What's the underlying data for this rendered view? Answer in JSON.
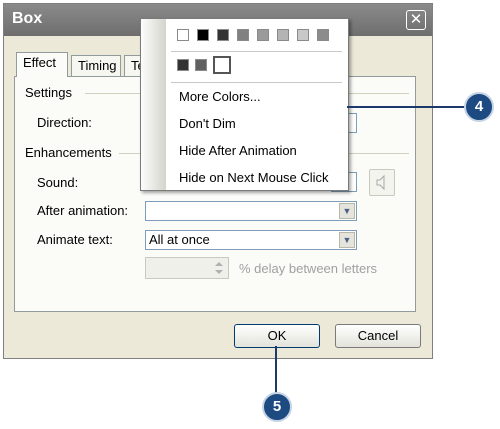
{
  "window": {
    "title": "Box",
    "close_glyph": "✕"
  },
  "tabs": [
    {
      "label": "Effect"
    },
    {
      "label": "Timing"
    },
    {
      "label": "Te"
    }
  ],
  "settings": {
    "group_label": "Settings",
    "direction_label": "Direction:"
  },
  "enhancements": {
    "group_label": "Enhancements",
    "sound_label": "Sound:",
    "after_animation_label": "After animation:",
    "after_animation_value": "",
    "animate_text_label": "Animate text:",
    "animate_text_value": "All at once",
    "delay_value": "",
    "delay_label": "% delay between letters"
  },
  "buttons": {
    "ok": "OK",
    "cancel": "Cancel"
  },
  "dropdown_menu": {
    "palette_colors": [
      "#ffffff",
      "#000000",
      "#333333",
      "#808080",
      "#9a9a9a",
      "#b4b4b4",
      "#c8c8c8",
      "#8c8c8c"
    ],
    "recent_colors": [
      "#333333",
      "#606060",
      "#ffffff"
    ],
    "items": [
      {
        "label": "More Colors..."
      },
      {
        "label": "Don't Dim"
      },
      {
        "label": "Hide After Animation"
      },
      {
        "label": "Hide on Next Mouse Click"
      }
    ]
  },
  "callouts": {
    "first": "4",
    "second": "5"
  },
  "colors": {
    "callout": "#1e4a82",
    "callout_line": "#1b3a6b",
    "titlebar": "#7a7a7a"
  }
}
